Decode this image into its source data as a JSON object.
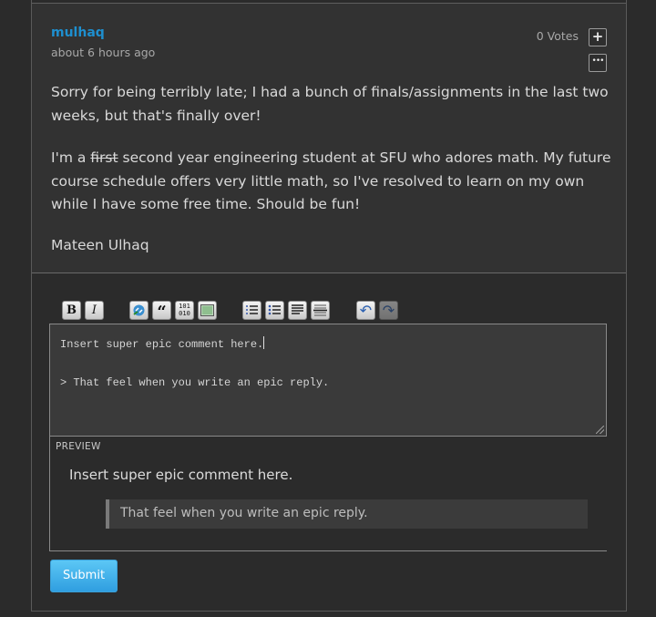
{
  "post": {
    "author": "mulhaq",
    "time": "about 6 hours ago",
    "votes": "0 Votes",
    "vote_up_symbol": "+",
    "more_symbol": "•••",
    "paragraph1": "Sorry for being terribly late; I had a bunch of finals/assignments in the last two weeks, but that's finally over!",
    "paragraph2_prefix": "I'm a ",
    "paragraph2_struck": "first",
    "paragraph2_rest": " second year engineering student at SFU who adores math. My future course schedule offers very little math, so I've resolved to learn on my own while I have some free time. Should be fun!",
    "signature": "Mateen Ulhaq"
  },
  "toolbar": {
    "bold": "B",
    "italic": "I",
    "link_icon": "link-icon",
    "quote": "“",
    "code": "101",
    "image_icon": "image-icon",
    "ordered_list_icon": "ordered-list-icon",
    "bullet_list_icon": "bullet-list-icon",
    "heading_icon": "heading-icon",
    "hr_icon": "horizontal-rule-icon",
    "undo": "↶",
    "redo": "↷"
  },
  "editor": {
    "line1": "Insert super epic comment here.",
    "line2": "",
    "line3": "> That feel when you write an epic reply."
  },
  "preview": {
    "label": "PREVIEW",
    "text": "Insert super epic comment here.",
    "quote": "That feel when you write an epic reply."
  },
  "submit_label": "Submit",
  "colors": {
    "author": "#1e8fcf",
    "submit": "#3aa8e8",
    "background": "#2b2b2b"
  }
}
